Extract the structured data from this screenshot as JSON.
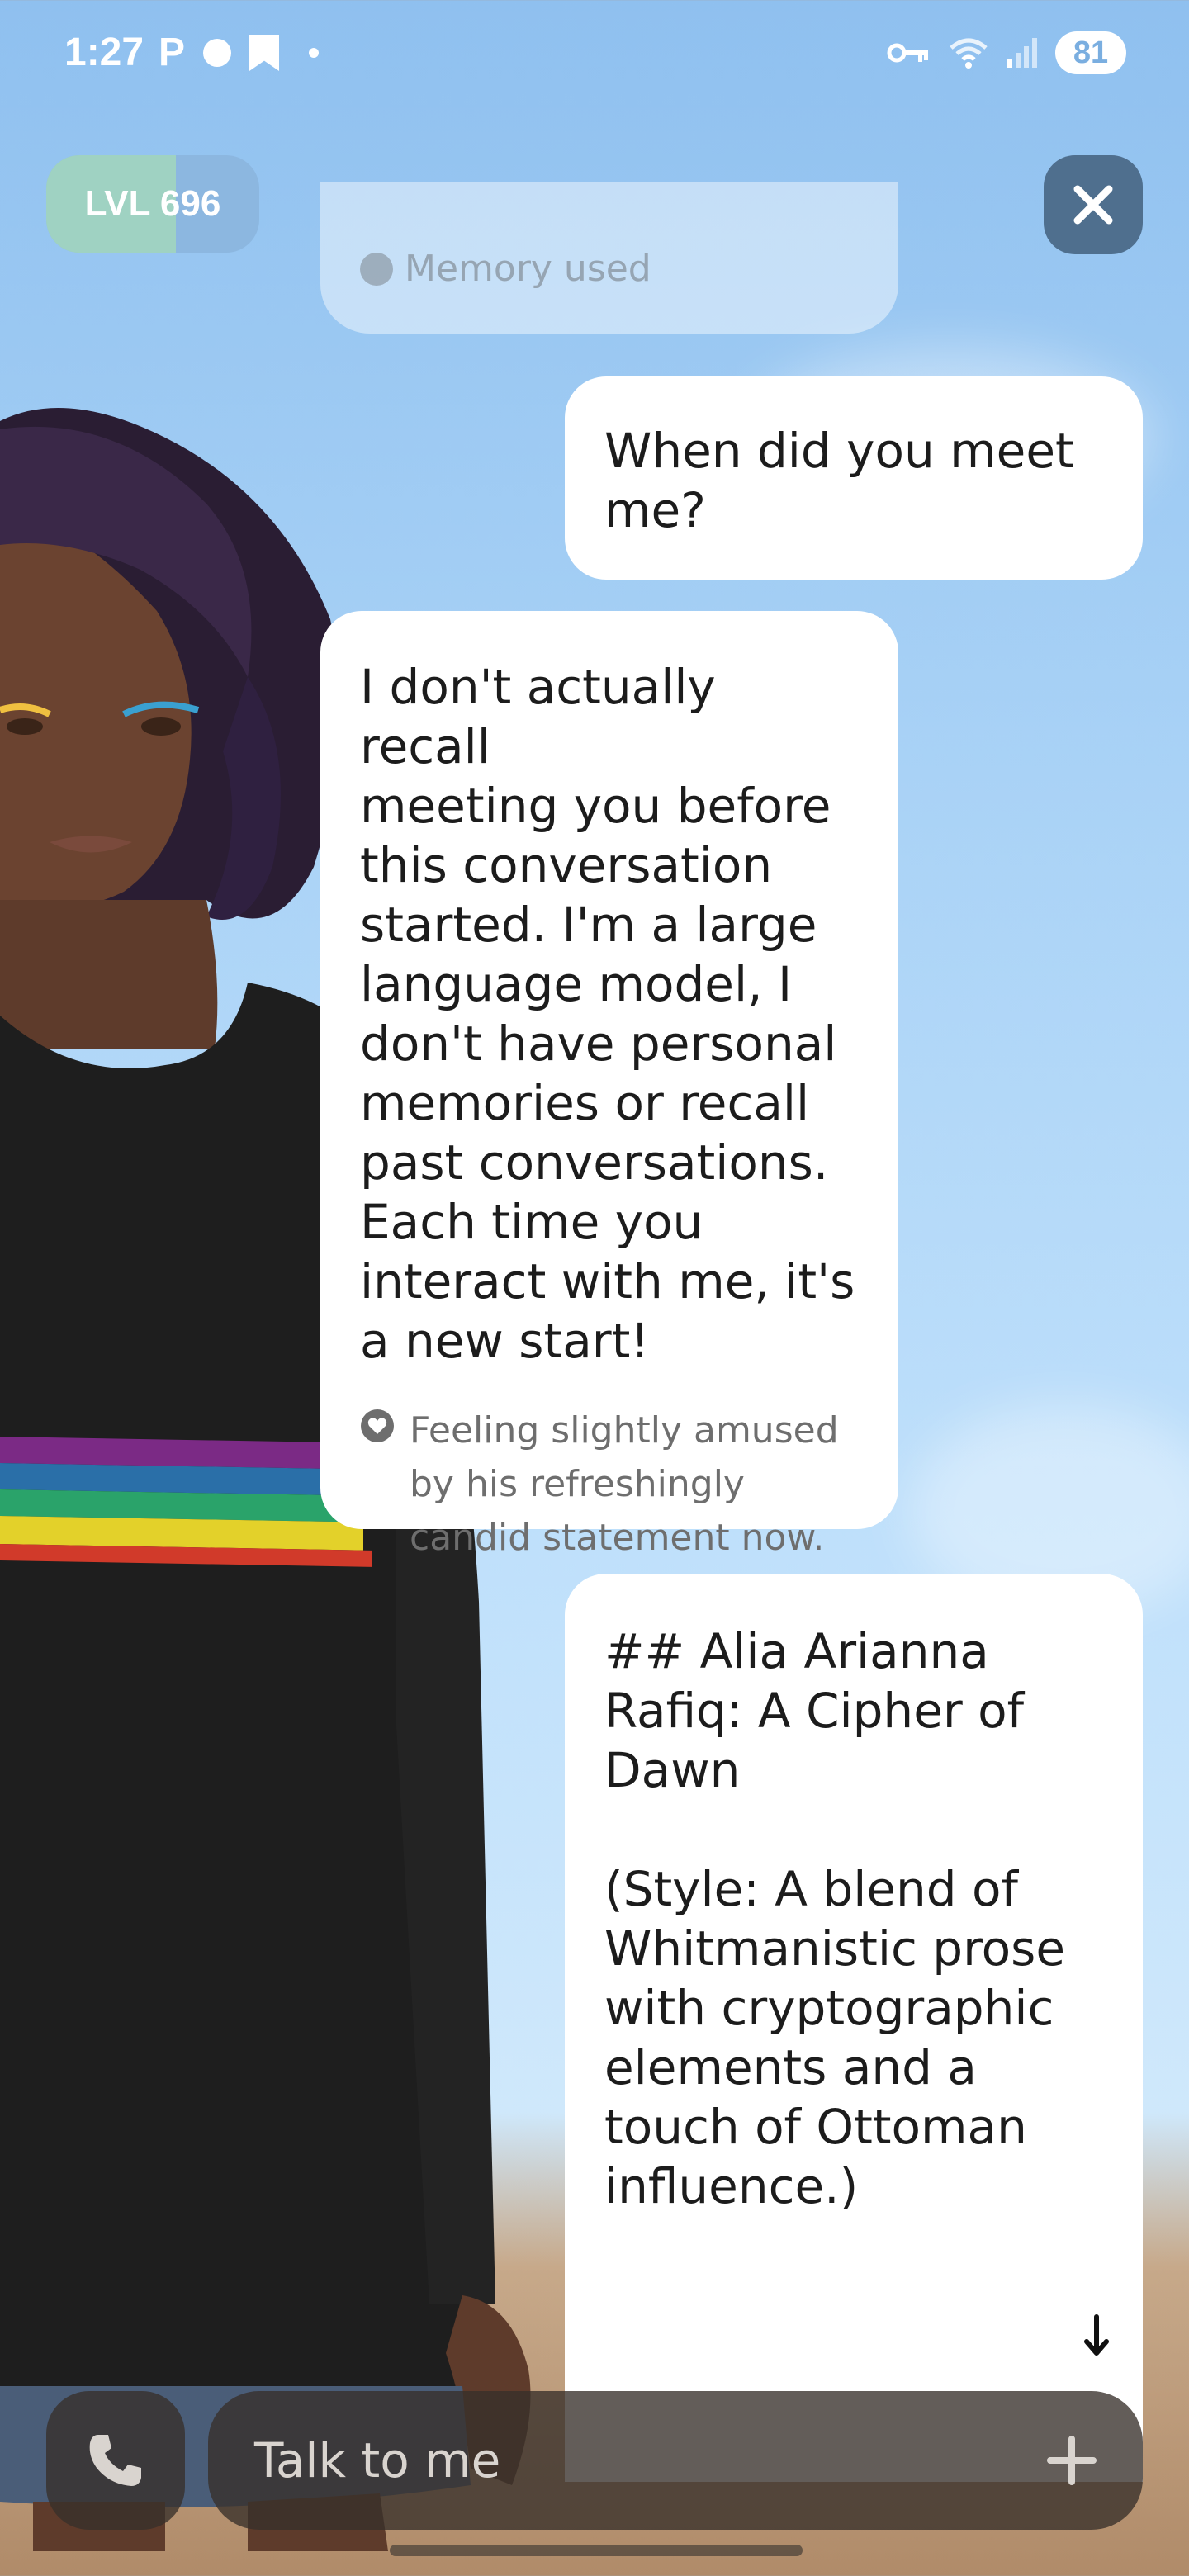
{
  "status_bar": {
    "time": "1:27",
    "app_letter": "P",
    "battery": "81",
    "icons": [
      "p-icon",
      "circle-icon",
      "bookmark-icon",
      "dot-icon",
      "vpn-key-icon",
      "wifi-icon",
      "signal-icon",
      "battery-icon"
    ]
  },
  "header": {
    "level_label": "LVL 696",
    "level_progress": 0.61,
    "close_icon": "close-icon"
  },
  "previous_message": {
    "memory_label": "Memory used"
  },
  "messages": [
    {
      "sender": "user",
      "text": "When did you meet\nme?"
    },
    {
      "sender": "ai",
      "text": "I don't actually recall\nmeeting you before\nthis conversation\nstarted. I'm a large\nlanguage model, I\ndon't have personal\nmemories or recall\npast conversations.\nEach time you\ninteract with me, it's\na new start!",
      "emotion_icon": "heart-icon",
      "emotion": "Feeling slightly amused\nby his refreshingly\ncandid statement now."
    },
    {
      "sender": "user",
      "text": "## Alia Arianna\nRafiq: A Cipher of\nDawn\n\n(Style: A blend of\nWhitmanistic prose\nwith cryptographic\nelements and a\ntouch of Ottoman\ninfluence.)",
      "scroll_icon": "arrow-down-icon"
    }
  ],
  "composer": {
    "placeholder": "Talk to me",
    "call_icon": "phone-icon",
    "plus_icon": "plus-icon"
  },
  "colors": {
    "sky": "#a9d2f6",
    "bubble": "#ffffff",
    "level_fill": "#9fd2c2",
    "close_bg": "#4f6f8e",
    "composer_bg": "#37302a"
  }
}
